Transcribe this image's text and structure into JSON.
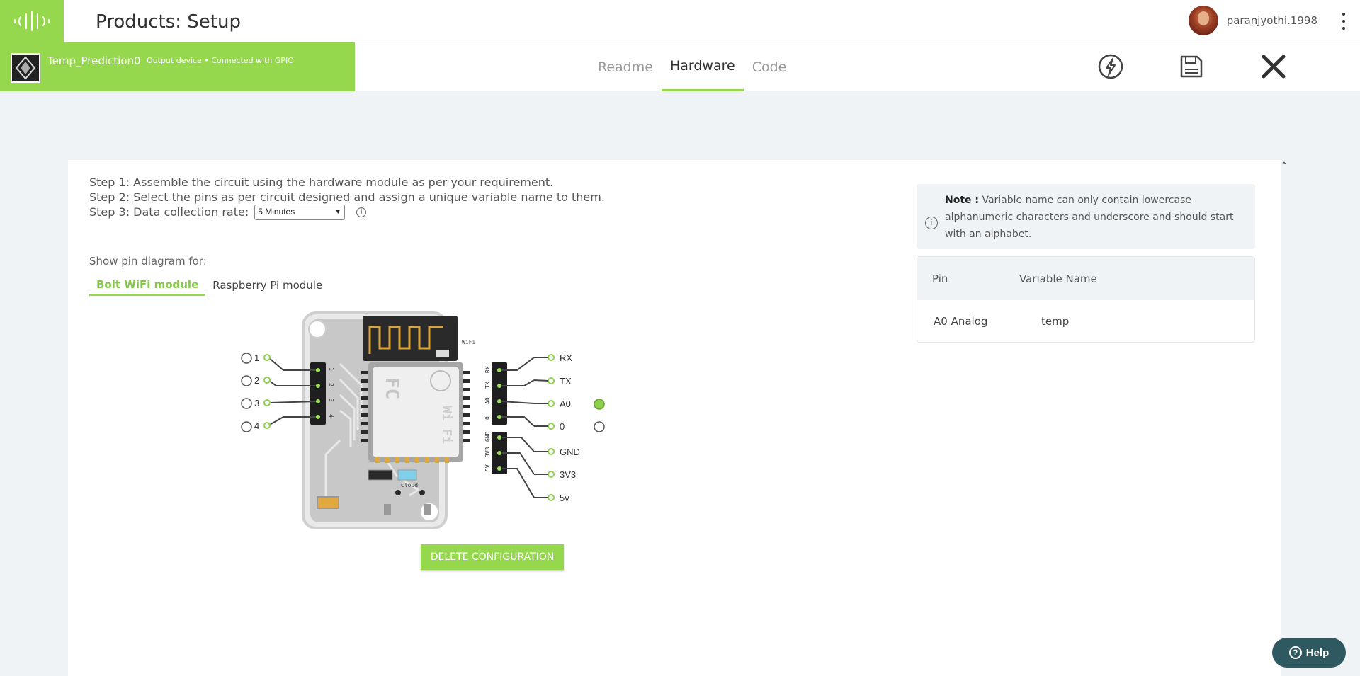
{
  "header": {
    "title": "Products: Setup",
    "username": "paranjyothi.1998"
  },
  "device": {
    "name": "Temp_Prediction0",
    "status": "Output device • Connected with GPIO"
  },
  "tabs": [
    {
      "label": "Readme",
      "active": false
    },
    {
      "label": "Hardware",
      "active": true
    },
    {
      "label": "Code",
      "active": false
    }
  ],
  "actions": {
    "deploy_icon": "lightning-icon",
    "save_icon": "save-icon",
    "close_icon": "close-icon"
  },
  "steps": {
    "step1": "Step 1: Assemble the circuit using the hardware module as per your requirement.",
    "step2": "Step 2: Select the pins as per circuit designed and assign a unique variable name to them.",
    "step3": "Step 3: Data collection rate:",
    "rate_value": "5 Minutes"
  },
  "pin_diagram": {
    "label": "Show pin diagram for:",
    "modules": [
      {
        "label": "Bolt WiFi module",
        "active": true
      },
      {
        "label": "Raspberry Pi module",
        "active": false
      }
    ],
    "left_pins": [
      "1",
      "2",
      "3",
      "4"
    ],
    "right_pins": [
      "RX",
      "TX",
      "A0",
      "0",
      "GND",
      "3V3",
      "5v"
    ],
    "selected_pin": "A0",
    "board_silk": {
      "wifi": "WiFi",
      "cloud": "Cloud",
      "chip_fc": "FC",
      "chip_wifi": "Wi Fi",
      "left_header": [
        "1",
        "2",
        "3",
        "4"
      ],
      "right_header": [
        "RX",
        "TX",
        "A0",
        "0",
        "GND",
        "3V3",
        "5V"
      ]
    }
  },
  "delete_button": "DELETE CONFIGURATION",
  "note": {
    "bold": "Note :",
    "text": "Variable name can only contain lowercase alphanumeric characters and underscore and should start with an alphabet."
  },
  "pin_table": {
    "headers": [
      "Pin",
      "Variable Name"
    ],
    "rows": [
      {
        "pin": "A0 Analog",
        "variable": "temp"
      }
    ]
  },
  "help": {
    "label": "Help"
  },
  "colors": {
    "brand_green": "#95d84d",
    "help_bg": "#2f5961",
    "page_bg": "#eff3f5"
  }
}
